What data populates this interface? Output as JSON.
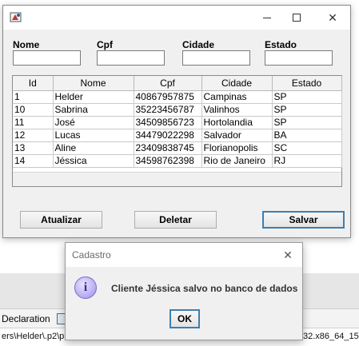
{
  "background": {
    "declaration_tab": "Declaration",
    "path_text": "ers\\Helder\\.p2\\p",
    "path_suffix": "32.x86_64_15"
  },
  "window": {
    "fields": [
      {
        "label": "Nome",
        "value": ""
      },
      {
        "label": "Cpf",
        "value": ""
      },
      {
        "label": "Cidade",
        "value": ""
      },
      {
        "label": "Estado",
        "value": ""
      }
    ],
    "table": {
      "columns": [
        "Id",
        "Nome",
        "Cpf",
        "Cidade",
        "Estado"
      ],
      "rows": [
        [
          "1",
          "Helder",
          "40867957875",
          "Campinas",
          "SP"
        ],
        [
          "10",
          "Sabrina",
          "35223456787",
          "Valinhos",
          "SP"
        ],
        [
          "11",
          "José",
          "34509856723",
          "Hortolandia",
          "SP"
        ],
        [
          "12",
          "Lucas",
          "34479022298",
          "Salvador",
          "BA"
        ],
        [
          "13",
          "Aline",
          "23409838745",
          "Florianopolis",
          "SC"
        ],
        [
          "14",
          "Jéssica",
          "34598762398",
          "Rio de Janeiro",
          "RJ"
        ]
      ]
    },
    "buttons": {
      "update": "Atualizar",
      "delete": "Deletar",
      "save": "Salvar"
    }
  },
  "dialog": {
    "title": "Cadastro",
    "message": "Cliente Jéssica salvo no banco de dados",
    "ok": "OK"
  }
}
